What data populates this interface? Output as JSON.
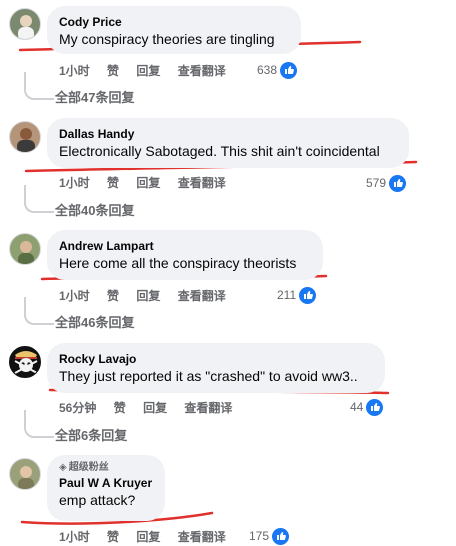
{
  "colors": {
    "accent": "#1877f2",
    "underline": "#e0312d",
    "bubble": "#f0f2f5",
    "meta": "#65676b"
  },
  "comments": [
    {
      "name": "Cody Price",
      "text": "My conspiracy theories are tingling",
      "time": "1小时",
      "like": "赞",
      "reply": "回复",
      "translate": "查看翻译",
      "likes": "638",
      "replies": "全部47条回复",
      "avatar": "avatar-photo-person"
    },
    {
      "name": "Dallas Handy",
      "text": "Electronically Sabotaged. This shit ain't coincidental",
      "time": "1小时",
      "like": "赞",
      "reply": "回复",
      "translate": "查看翻译",
      "likes": "579",
      "replies": "全部40条回复",
      "avatar": "avatar-photo-person"
    },
    {
      "name": "Andrew Lampart",
      "text": "Here come all the conspiracy theorists",
      "time": "1小时",
      "like": "赞",
      "reply": "回复",
      "translate": "查看翻译",
      "likes": "211",
      "replies": "全部46条回复",
      "avatar": "avatar-photo-person"
    },
    {
      "name": "Rocky Lavajo",
      "text": "They just reported it as \"crashed\" to avoid ww3..",
      "time": "56分钟",
      "like": "赞",
      "reply": "回复",
      "translate": "查看翻译",
      "likes": "44",
      "replies": "全部6条回复",
      "avatar": "avatar-skull-pirate"
    },
    {
      "name": "Paul W A Kruyer",
      "badge": "超级粉丝",
      "text": "emp attack?",
      "time": "1小时",
      "like": "赞",
      "reply": "回复",
      "translate": "查看翻译",
      "likes": "175",
      "avatar": "avatar-photo-person"
    }
  ]
}
